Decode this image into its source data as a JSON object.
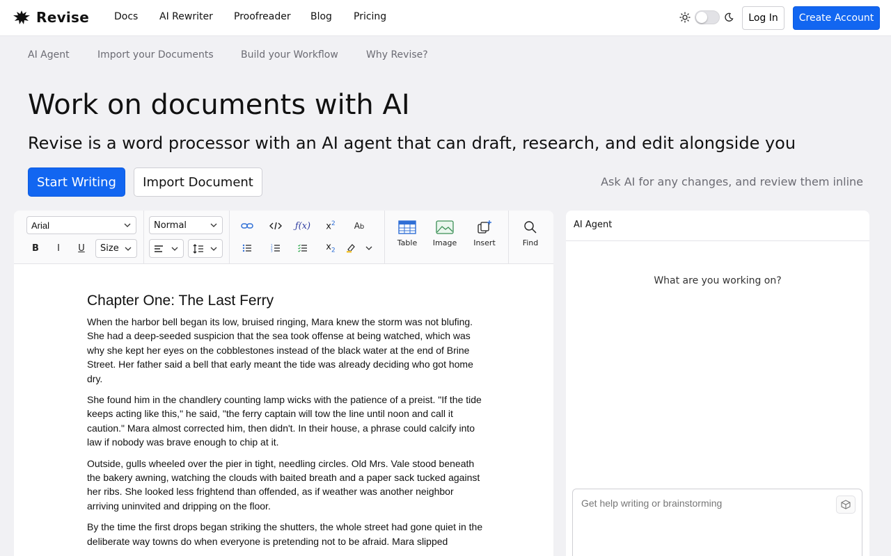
{
  "brand": {
    "name": "Revise",
    "logo_icon": "leaf-icon"
  },
  "nav": {
    "links": [
      "Docs",
      "AI Rewriter",
      "Proofreader",
      "Blog",
      "Pricing"
    ]
  },
  "header_actions": {
    "login": "Log In",
    "create_account": "Create Account"
  },
  "subnav": {
    "links": [
      "AI Agent",
      "Import your Documents",
      "Build your Workflow",
      "Why Revise?"
    ]
  },
  "hero": {
    "title": "Work on documents with AI",
    "subtitle": "Revise is a word processor with an AI agent that can draft, research, and edit alongside you",
    "primary_button": "Start Writing",
    "secondary_button": "Import Document",
    "hint": "Ask AI for any changes, and review them inline"
  },
  "toolbar": {
    "font": "Arial",
    "style": "Normal",
    "size": "Size",
    "bold": "B",
    "italic": "I",
    "underline": "U",
    "table": "Table",
    "image": "Image",
    "insert": "Insert",
    "find": "Find"
  },
  "document": {
    "title": "Chapter One: The Last Ferry",
    "paragraphs": [
      "When the harbor bell began its low, bruised ringing, Mara knew the storm was not blufing. She had a deep-seeded suspicion that the sea took offense at being watched, which was why she kept her eyes on the cobblestones instead of the black water at the end of Brine Street. Her father said a bell that early meant the tide was already deciding who got home dry.",
      "She found him in the chandlery counting lamp wicks with the patience of a preist. \"If the tide keeps acting like this,\" he said, \"the ferry captain will tow the line until noon and call it caution.\" Mara almost corrected him, then didn't. In their house, a phrase could calcify into law if nobody was brave enough to chip at it.",
      "Outside, gulls wheeled over the pier in tight, needling circles. Old Mrs. Vale stood beneath the bakery awning, watching the clouds with baited breath and a paper sack tucked against her ribs. She looked less frightend than offended, as if weather was another neighbor arriving uninvited and dripping on the floor.",
      "By the time the first drops began striking the shutters, the whole street had gone quiet in the deliberate way towns do when everyone is pretending not to be afraid. Mara slipped"
    ]
  },
  "ai_agent": {
    "title": "AI Agent",
    "prompt": "What are you working on?",
    "input_placeholder": "Get help writing or brainstorming"
  }
}
